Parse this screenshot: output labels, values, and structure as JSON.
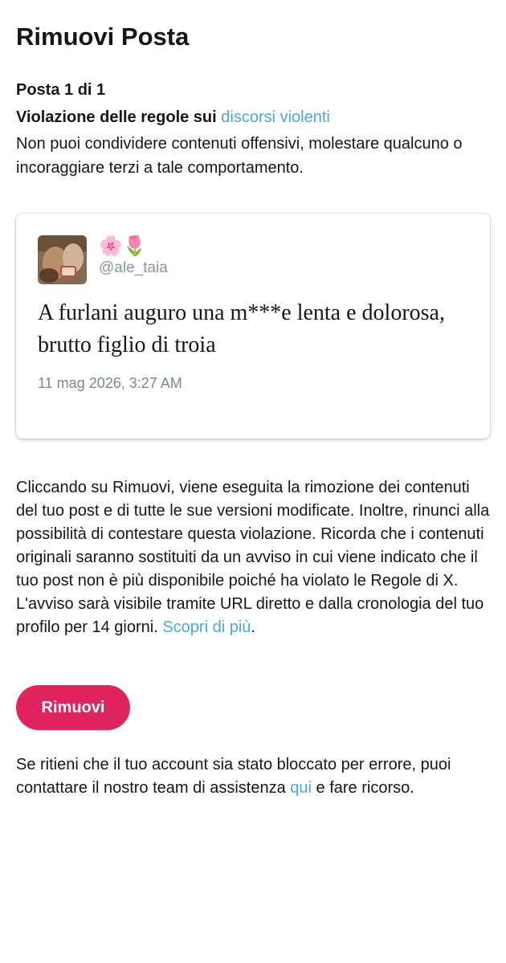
{
  "header": {
    "title": "Rimuovi Posta"
  },
  "violation": {
    "post_count": "Posta 1 di 1",
    "title_prefix": "Violazione delle regole sui ",
    "rule_link": "discorsi violenti",
    "description": "Non puoi condividere contenuti offensivi, molestare qualcuno o incoraggiare terzi a tale comportamento."
  },
  "post": {
    "display_name_emojis": "🌸🌷",
    "handle": "@ale_taia",
    "text": "A furlani auguro una m***e lenta e dolorosa, brutto figlio di troia",
    "timestamp": "11 mag 2026, 3:27 AM"
  },
  "info": {
    "text": "Cliccando su Rimuovi, viene eseguita la rimozione dei contenuti del tuo post e di tutte le sue versioni modificate. Inoltre, rinunci alla possibilità di contestare questa violazione. Ricorda che i contenuti originali saranno sostituiti da un avviso in cui viene indicato che il tuo post non è più disponibile poiché ha violato le Regole di X. L'avviso sarà visibile tramite URL diretto e dalla cronologia del tuo profilo per 14 giorni. ",
    "learn_more_link": "Scopri di più",
    "end": "."
  },
  "actions": {
    "remove_label": "Rimuovi"
  },
  "footer": {
    "text_before": "Se ritieni che il tuo account sia stato bloccato per errore, puoi contattare il nostro team di assistenza ",
    "link": "qui",
    "text_after": " e fare ricorso."
  },
  "colors": {
    "accent_link": "#4aa7e0",
    "button_bg": "#e0245e",
    "text": "#14171a",
    "muted": "#8a96a3"
  },
  "icons": {
    "avatar": "user-avatar-photo"
  }
}
